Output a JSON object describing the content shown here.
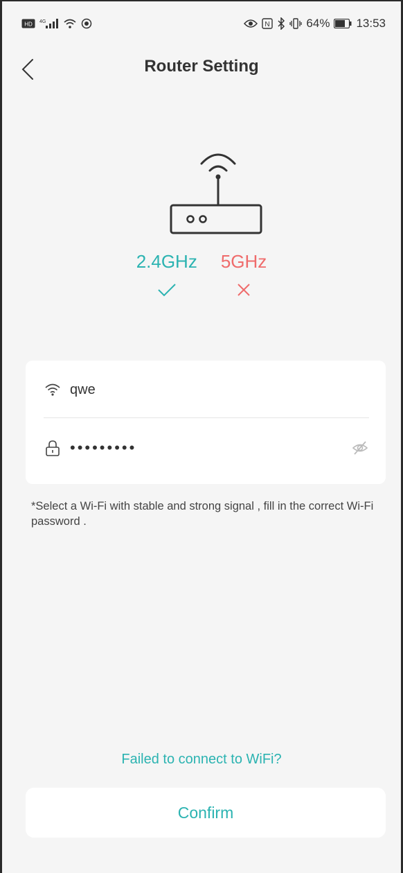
{
  "status_bar": {
    "left_icons": [
      "hd-icon",
      "signal-4g-icon",
      "wifi-icon",
      "record-icon"
    ],
    "right_icons": [
      "eye-icon",
      "nfc-icon",
      "bluetooth-icon",
      "vibrate-icon"
    ],
    "battery_percent": "64%",
    "time": "13:53"
  },
  "header": {
    "title": "Router Setting"
  },
  "bands": [
    {
      "label": "2.4GHz",
      "status": "supported",
      "color": "#2bb3b1"
    },
    {
      "label": "5GHz",
      "status": "unsupported",
      "color": "#ef6b6b"
    }
  ],
  "form": {
    "ssid": "qwe",
    "password_masked": "•••••••••"
  },
  "hint": "*Select a Wi-Fi with stable and strong signal , fill in the correct Wi-Fi password .",
  "failed_link": "Failed to connect to WiFi?",
  "confirm_label": "Confirm",
  "colors": {
    "accent": "#2bb3b1",
    "error": "#ef6b6b",
    "background": "#f5f5f5"
  }
}
